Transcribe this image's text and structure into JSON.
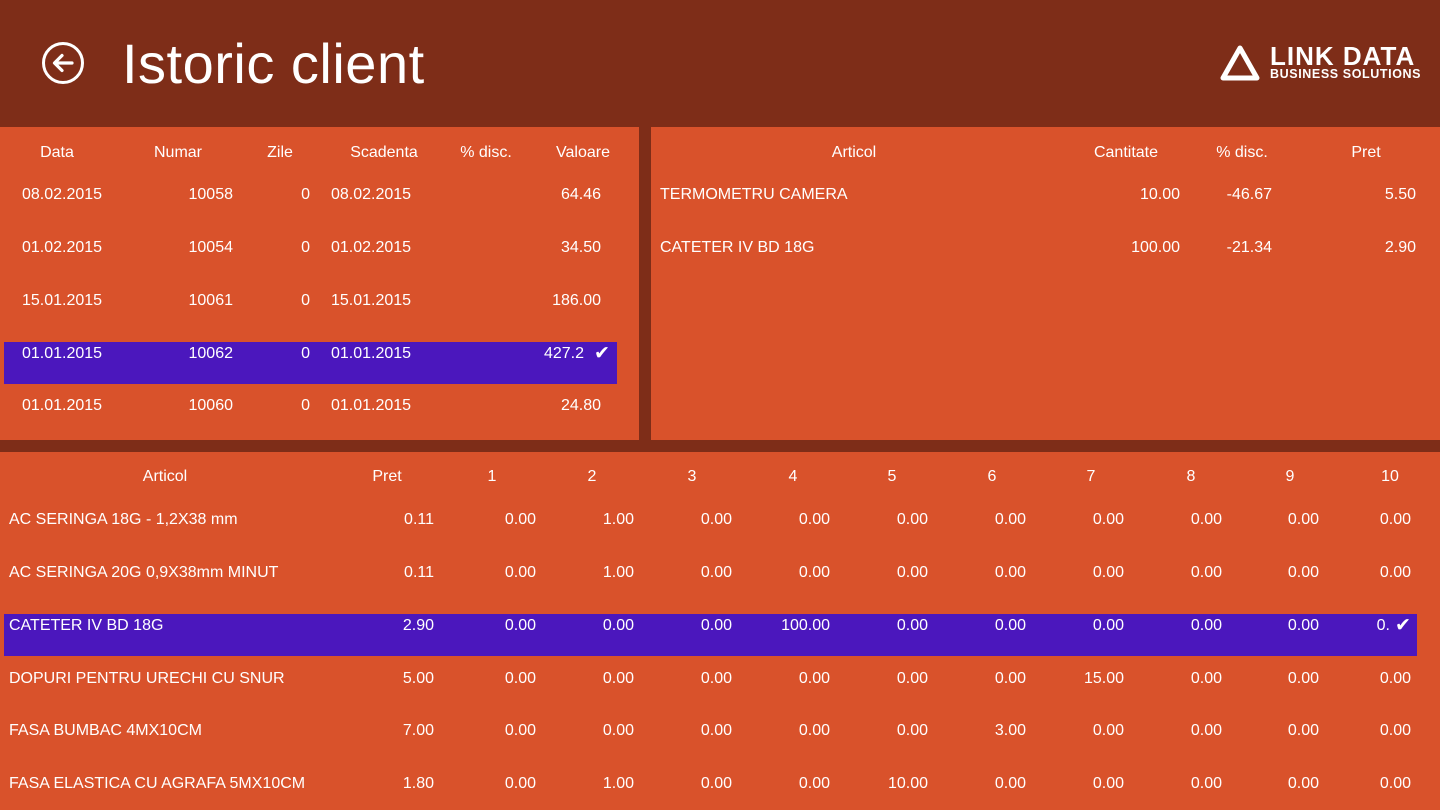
{
  "header": {
    "title": "Istoric client",
    "logo_main": "LINK DATA",
    "logo_sub": "BUSINESS SOLUTIONS"
  },
  "invoices": {
    "columns": [
      "Data",
      "Numar",
      "Zile",
      "Scadenta",
      "% disc.",
      "Valoare"
    ],
    "rows": [
      {
        "data": "08.02.2015",
        "numar": "10058",
        "zile": "0",
        "scadenta": "08.02.2015",
        "disc": "",
        "valoare": "64.46",
        "selected": false
      },
      {
        "data": "01.02.2015",
        "numar": "10054",
        "zile": "0",
        "scadenta": "01.02.2015",
        "disc": "",
        "valoare": "34.50",
        "selected": false
      },
      {
        "data": "15.01.2015",
        "numar": "10061",
        "zile": "0",
        "scadenta": "15.01.2015",
        "disc": "",
        "valoare": "186.00",
        "selected": false
      },
      {
        "data": "01.01.2015",
        "numar": "10062",
        "zile": "0",
        "scadenta": "01.01.2015",
        "disc": "",
        "valoare": "427.2",
        "selected": true
      },
      {
        "data": "01.01.2015",
        "numar": "10060",
        "zile": "0",
        "scadenta": "01.01.2015",
        "disc": "",
        "valoare": "24.80",
        "selected": false
      }
    ]
  },
  "invoice_items": {
    "columns": [
      "Articol",
      "Cantitate",
      "% disc.",
      "Pret"
    ],
    "rows": [
      {
        "articol": "TERMOMETRU CAMERA",
        "cantitate": "10.00",
        "disc": "-46.67",
        "pret": "5.50"
      },
      {
        "articol": "CATETER IV BD 18G",
        "cantitate": "100.00",
        "disc": "-21.34",
        "pret": "2.90"
      }
    ]
  },
  "history": {
    "columns": [
      "Articol",
      "Pret",
      "1",
      "2",
      "3",
      "4",
      "5",
      "6",
      "7",
      "8",
      "9",
      "10"
    ],
    "rows": [
      {
        "articol": "AC SERINGA 18G - 1,2X38 mm",
        "pret": "0.11",
        "v": [
          "0.00",
          "1.00",
          "0.00",
          "0.00",
          "0.00",
          "0.00",
          "0.00",
          "0.00",
          "0.00",
          "0.00"
        ],
        "selected": false
      },
      {
        "articol": "AC SERINGA 20G 0,9X38mm MINUT",
        "pret": "0.11",
        "v": [
          "0.00",
          "1.00",
          "0.00",
          "0.00",
          "0.00",
          "0.00",
          "0.00",
          "0.00",
          "0.00",
          "0.00"
        ],
        "selected": false
      },
      {
        "articol": "CATETER IV BD 18G",
        "pret": "2.90",
        "v": [
          "0.00",
          "0.00",
          "0.00",
          "100.00",
          "0.00",
          "0.00",
          "0.00",
          "0.00",
          "0.00",
          "0."
        ],
        "selected": true
      },
      {
        "articol": "DOPURI PENTRU URECHI CU SNUR",
        "pret": "5.00",
        "v": [
          "0.00",
          "0.00",
          "0.00",
          "0.00",
          "0.00",
          "0.00",
          "15.00",
          "0.00",
          "0.00",
          "0.00"
        ],
        "selected": false
      },
      {
        "articol": "FASA BUMBAC 4MX10CM",
        "pret": "7.00",
        "v": [
          "0.00",
          "0.00",
          "0.00",
          "0.00",
          "0.00",
          "3.00",
          "0.00",
          "0.00",
          "0.00",
          "0.00"
        ],
        "selected": false
      },
      {
        "articol": "FASA ELASTICA CU AGRAFA 5MX10CM",
        "pret": "1.80",
        "v": [
          "0.00",
          "1.00",
          "0.00",
          "0.00",
          "10.00",
          "0.00",
          "0.00",
          "0.00",
          "0.00",
          "0.00"
        ],
        "selected": false
      }
    ]
  },
  "icons": {
    "back": "arrow-left-circle-icon",
    "check": "checkmark-icon",
    "logo": "triangle-logo-icon"
  },
  "colors": {
    "header_bg": "#7e2d18",
    "panel_bg": "#d9522b",
    "selection": "#4b17bd",
    "text": "#ffffff"
  }
}
